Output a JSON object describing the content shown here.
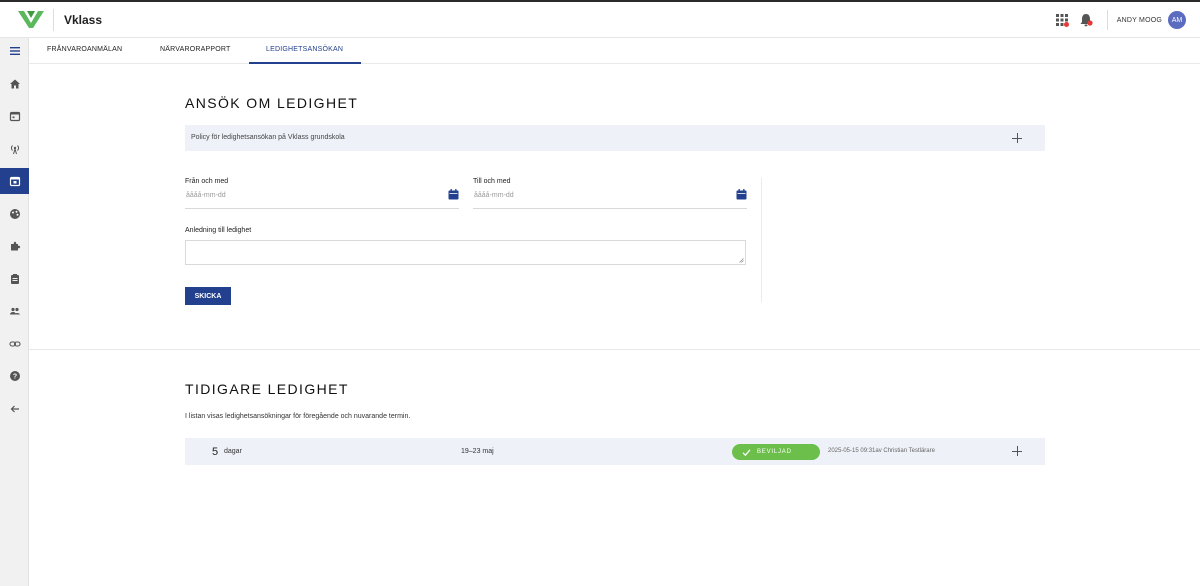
{
  "app": {
    "brand": "Vklass"
  },
  "header": {
    "user_name": "ANDY MOOG",
    "avatar_initials": "AM"
  },
  "colors": {
    "primary": "#23408e",
    "accent_green": "#6cbf4b",
    "panel_bg": "#eef1f8",
    "logo_green": "#5cb85c"
  },
  "sidebar": {
    "items": [
      {
        "icon": "menu-icon"
      },
      {
        "icon": "home-icon"
      },
      {
        "icon": "calendar-icon"
      },
      {
        "icon": "broadcast-icon"
      },
      {
        "icon": "calendar-check-icon",
        "active": true
      },
      {
        "icon": "palette-icon"
      },
      {
        "icon": "puzzle-icon"
      },
      {
        "icon": "clipboard-icon"
      },
      {
        "icon": "people-icon"
      },
      {
        "icon": "link-icon"
      },
      {
        "icon": "help-icon"
      },
      {
        "icon": "back-arrow-icon"
      }
    ]
  },
  "tabs": [
    {
      "label": "FRÅNVAROANMÄLAN"
    },
    {
      "label": "NÄRVARORAPPORT"
    },
    {
      "label": "LEDIGHETSANSÖKAN",
      "active": true
    }
  ],
  "apply": {
    "title": "ANSÖK OM LEDIGHET",
    "policy": "Policy för ledighetsansökan på Vklass grundskola",
    "from_label": "Från och med",
    "from_placeholder": "åååå-mm-dd",
    "to_label": "Till och med",
    "to_placeholder": "åååå-mm-dd",
    "reason_label": "Anledning till ledighet",
    "submit_label": "SKICKA"
  },
  "history": {
    "title": "TIDIGARE LEDIGHET",
    "description": "I listan visas ledighetsansökningar för föregående och nuvarande termin.",
    "rows": [
      {
        "count": "5",
        "unit": "dagar",
        "dates": "19–23 maj",
        "status": "BEVILJAD",
        "meta": "2025-05-15 09:31av Christian Testlärare"
      }
    ]
  }
}
